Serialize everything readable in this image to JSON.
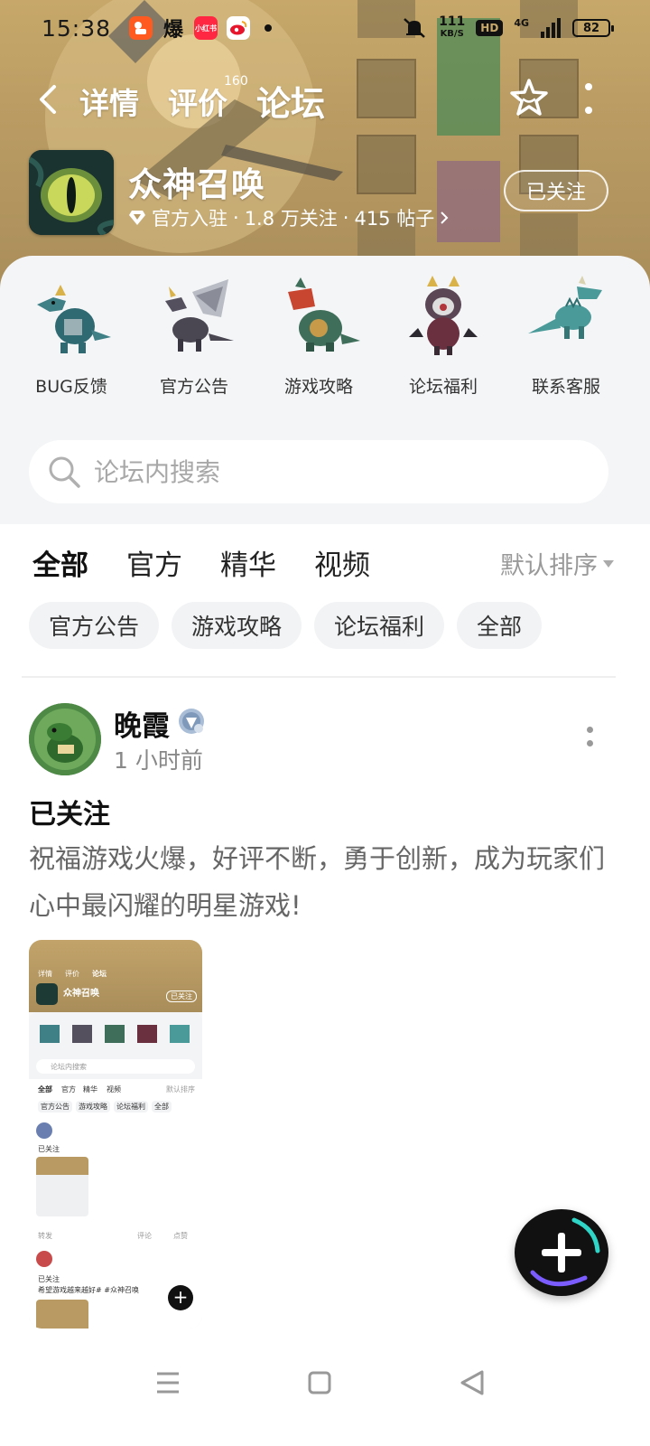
{
  "status_bar": {
    "time": "15:38",
    "net_speed_value": "111",
    "net_speed_unit": "KB/S",
    "hd": "HD",
    "signal": "4G",
    "battery": "82",
    "app_icons": [
      "kuaishou-icon",
      "bao-icon",
      "xiaohongshu-icon",
      "weibo-icon"
    ],
    "app_bao": "爆",
    "app_xhs": "小红书"
  },
  "nav": {
    "tabs": [
      {
        "label": "详情"
      },
      {
        "label": "评价"
      },
      {
        "label": "论坛"
      }
    ],
    "review_count": "160",
    "active_tab": "论坛"
  },
  "game": {
    "title": "众神召唤",
    "verified_label": "官方入驻",
    "followers": "1.8 万关注",
    "posts": "415 帖子",
    "sep": "·",
    "follow_button": "已关注"
  },
  "shortcuts": [
    {
      "label": "BUG反馈"
    },
    {
      "label": "官方公告"
    },
    {
      "label": "游戏攻略"
    },
    {
      "label": "论坛福利"
    },
    {
      "label": "联系客服"
    }
  ],
  "search": {
    "placeholder": "论坛内搜索"
  },
  "filter": {
    "tabs": [
      {
        "label": "全部"
      },
      {
        "label": "官方"
      },
      {
        "label": "精华"
      },
      {
        "label": "视频"
      }
    ],
    "sort_label": "默认排序",
    "chips": [
      "官方公告",
      "游戏攻略",
      "论坛福利",
      "全部"
    ]
  },
  "post": {
    "author": "晚霞",
    "time": "1 小时前",
    "title": "已关注",
    "body": "祝福游戏火爆，好评不断，勇于创新，成为玩家们心中最闪耀的明星游戏!"
  },
  "mini": {
    "tabs": [
      "详情",
      "评价",
      "论坛"
    ],
    "title": "众神召唤",
    "follow": "已关注",
    "search": "论坛内搜索",
    "filters": [
      "全部",
      "官方",
      "精华",
      "视频"
    ],
    "sort": "默认排序",
    "chips": [
      "官方公告",
      "游戏攻略",
      "论坛福利",
      "全部"
    ],
    "post_title": "已关注",
    "post2_title": "已关注",
    "post2_body": "希望游戏越来越好# #众神召唤",
    "comment": "评论",
    "like": "点赞",
    "share": "转发"
  },
  "colors": {
    "accent": "#23d0c3",
    "banner": "#b89a62"
  }
}
